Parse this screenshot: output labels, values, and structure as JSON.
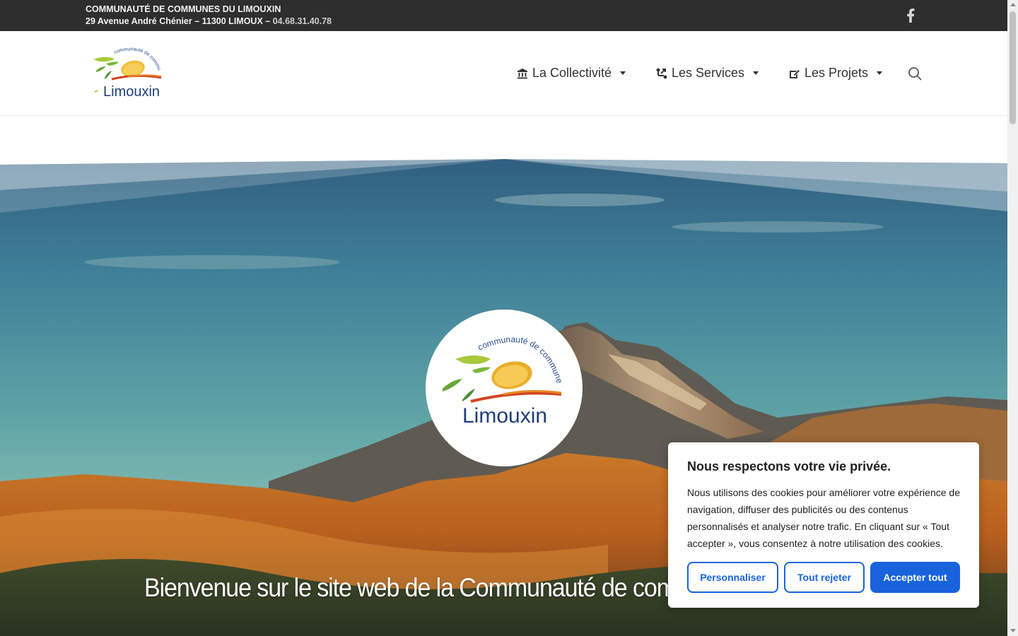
{
  "topbar": {
    "org_name": "COMMUNAUTÉ DE COMMUNES DU LIMOUXIN",
    "address": "29 Avenue André Chénier – 11300 LIMOUX – ",
    "phone": "04.68.31.40.78",
    "social_icon": "facebook-icon"
  },
  "header": {
    "logo_text_top": "communauté de communes",
    "logo_text_main": "Limouxin",
    "nav": [
      {
        "label": "La Collectivité",
        "icon": "building-icon"
      },
      {
        "label": "Les Services",
        "icon": "route-icon"
      },
      {
        "label": "Les Projets",
        "icon": "edit-icon"
      }
    ],
    "search_icon": "search-icon"
  },
  "hero": {
    "logo_text_top": "communauté de communes",
    "logo_text_main": "Limouxin",
    "title": "Bienvenue sur le site web de la Communauté de comm"
  },
  "cookie": {
    "title": "Nous respectons votre vie privée.",
    "text": "Nous utilisons des cookies pour améliorer votre expérience de navigation, diffuser des publicités ou des contenus personnalisés et analyser notre trafic. En cliquant sur « Tout accepter », vous consentez à notre utilisation des cookies.",
    "btn_customize": "Personnaliser",
    "btn_reject": "Tout rejeter",
    "btn_accept": "Accepter tout"
  },
  "colors": {
    "topbar_bg": "#2e2e2e",
    "accent_blue": "#1863dc",
    "logo_navy": "#1f3f7a"
  }
}
